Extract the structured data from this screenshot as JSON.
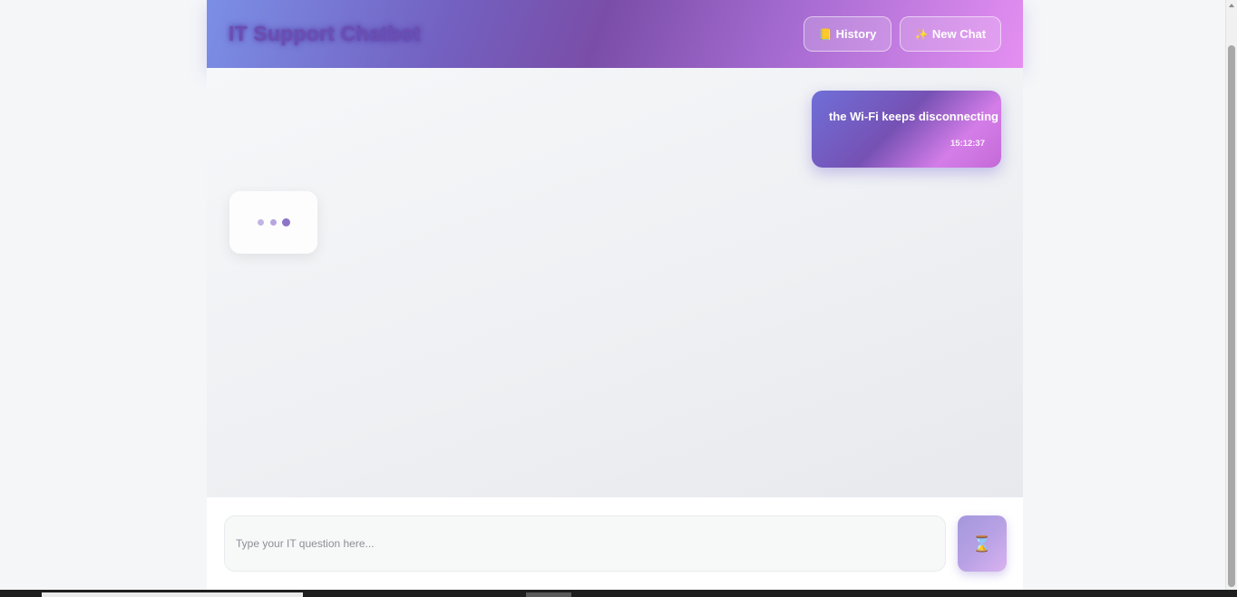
{
  "header": {
    "title": "IT Support Chatbot",
    "history_label": "History",
    "history_icon": "📒",
    "new_chat_label": "New Chat",
    "new_chat_icon": "✨"
  },
  "messages": [
    {
      "role": "user",
      "text": "the Wi-Fi keeps disconnecting",
      "time": "15:12:37"
    },
    {
      "role": "assistant",
      "status": "typing"
    }
  ],
  "composer": {
    "placeholder": "Type your IT question here...",
    "value": "",
    "send_icon": "⌛",
    "send_state": "loading"
  },
  "colors": {
    "accent_start": "#7b8fe6",
    "accent_mid": "#7a4ea8",
    "accent_end": "#e58ff2",
    "title": "#6a4fb0"
  }
}
